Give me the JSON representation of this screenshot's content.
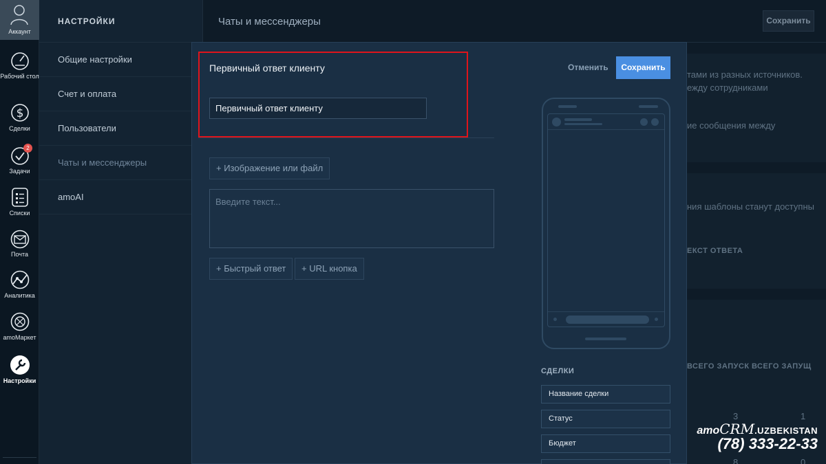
{
  "rail": {
    "account_label": "Аккаунт",
    "items": [
      {
        "label": "Рабочий стол",
        "icon": "dashboard-icon"
      },
      {
        "label": "Сделки",
        "icon": "dollar-icon"
      },
      {
        "label": "Задачи",
        "icon": "check-icon",
        "badge": "2"
      },
      {
        "label": "Списки",
        "icon": "list-icon"
      },
      {
        "label": "Почта",
        "icon": "mail-icon"
      },
      {
        "label": "Аналитика",
        "icon": "analytics-icon"
      },
      {
        "label": "amoМаркет",
        "icon": "market-icon"
      },
      {
        "label": "Настройки",
        "icon": "wrench-icon"
      }
    ]
  },
  "settings_nav": {
    "heading": "НАСТРОЙКИ",
    "items": [
      "Общие настройки",
      "Счет и оплата",
      "Пользователи",
      "Чаты и мессенджеры",
      "amoAI"
    ],
    "active": "Чаты и мессенджеры"
  },
  "page": {
    "title": "Чаты и мессенджеры",
    "save_label": "Сохранить",
    "bg_texts": [
      "тами из разных источников.",
      "ежду сотрудниками",
      "ие сообщения между",
      "ния шаблоны станут доступны"
    ],
    "bg_caption_1": "ЕКСТ ОТВЕТА",
    "bg_col_1": "ВСЕГО ЗАПУСК",
    "bg_col_2": "ВСЕГО ЗАПУЩ",
    "bg_nums": [
      "3",
      "1",
      "8",
      "0"
    ]
  },
  "modal": {
    "title": "Первичный ответ клиенту",
    "name_value": "Первичный ответ клиенту",
    "cancel_label": "Отменить",
    "save_label": "Сохранить",
    "attach_label": "+ Изображение или файл",
    "text_placeholder": "Введите текст...",
    "quick_reply_label": "+ Быстрый ответ",
    "url_button_label": "+ URL кнопка",
    "fields_caption": "СДЕЛКИ",
    "fields": [
      "Название сделки",
      "Статус",
      "Бюджет"
    ]
  },
  "watermark": {
    "brand_prefix": "amo",
    "brand_crm": "CRM",
    "brand_suffix": ".UZBEKISTAN",
    "phone": "(78) 333-22-33"
  },
  "colors": {
    "accent": "#4a8fe2",
    "highlight": "#e0141b",
    "badge": "#e3534f"
  }
}
